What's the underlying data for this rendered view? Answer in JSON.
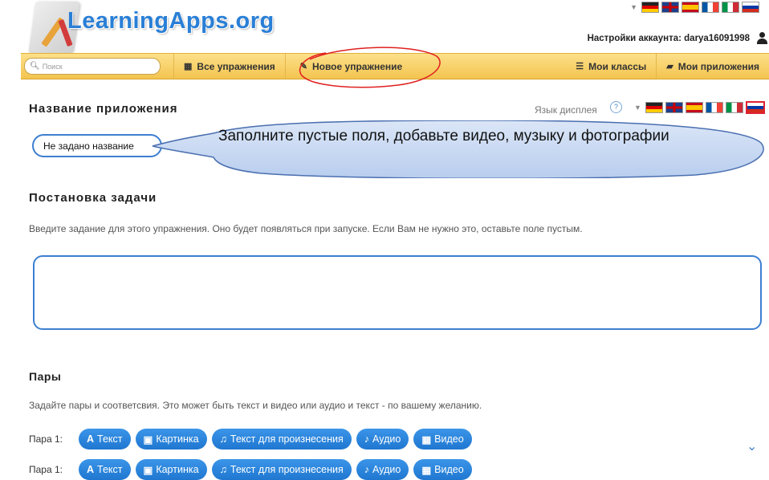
{
  "header": {
    "logo_text": "LearningApps.org",
    "account_text": "Настройки аккаунта: darya16091998",
    "language_flags": [
      "de",
      "gb",
      "es",
      "fr",
      "it",
      "ru"
    ]
  },
  "navbar": {
    "search_placeholder": "Поиск",
    "all_exercises": "Все упражнения",
    "new_exercise": "Новое упражнение",
    "my_classes": "Мои классы",
    "my_apps": "Мои приложения"
  },
  "form": {
    "app_name_title": "Название приложения",
    "display_language_label": "Язык дисплея",
    "title_input_value": "Не задано название",
    "callout_text": "Заполните пустые поля, добавьте видео, музыку и фотографии",
    "task_title": "Постановка задачи",
    "task_hint": "Введите задание для этого упражнения. Оно будет появляться при запуске. Если Вам не нужно это, оставьте поле пустым.",
    "pairs_title": "Пары",
    "pairs_hint": "Задайте пары и соответсвия. Это может быть текст и видео или аудио и текст - по вашему желанию."
  },
  "pairs": [
    {
      "label": "Пара 1:",
      "buttons": [
        "Текст",
        "Картинка",
        "Текст для произнесения",
        "Аудио",
        "Видео"
      ]
    },
    {
      "label": "Пара 1:",
      "buttons": [
        "Текст",
        "Картинка",
        "Текст для произнесения",
        "Аудио",
        "Видео"
      ]
    }
  ],
  "colors": {
    "accent_blue": "#2a7fd6",
    "navbar_yellow": "#f3c44f",
    "annotation_red": "#e02020",
    "callout_fill": "#c9d9f2"
  }
}
